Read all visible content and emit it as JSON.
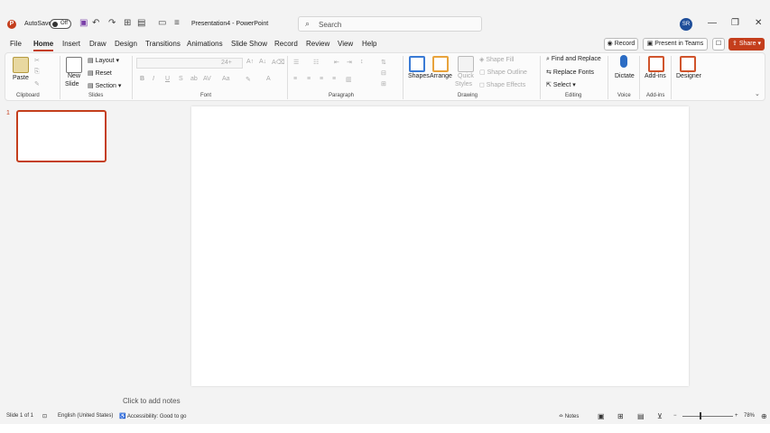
{
  "titlebar": {
    "autosave_label": "AutoSave",
    "autosave_state": "Off",
    "doc_title": "Presentation4 - PowerPoint",
    "search_placeholder": "Search",
    "avatar_initials": "SR"
  },
  "menu": [
    "File",
    "Home",
    "Insert",
    "Draw",
    "Design",
    "Transitions",
    "Animations",
    "Slide Show",
    "Record",
    "Review",
    "View",
    "Help"
  ],
  "menu_active": "Home",
  "actions": {
    "record": "Record",
    "present_teams": "Present in Teams",
    "share": "Share"
  },
  "ribbon": {
    "clipboard": {
      "paste": "Paste",
      "label": "Clipboard"
    },
    "slides": {
      "new_slide_1": "New",
      "new_slide_2": "Slide",
      "layout": "Layout",
      "reset": "Reset",
      "section": "Section",
      "label": "Slides"
    },
    "font": {
      "label": "Font",
      "size": "24+",
      "bold": "B",
      "italic": "I",
      "underline": "U",
      "strike": "S"
    },
    "paragraph": {
      "label": "Paragraph"
    },
    "drawing": {
      "shapes": "Shapes",
      "arrange": "Arrange",
      "quick_styles_1": "Quick",
      "quick_styles_2": "Styles",
      "shape_fill": "Shape Fill",
      "shape_outline": "Shape Outline",
      "shape_effects": "Shape Effects",
      "label": "Drawing"
    },
    "editing": {
      "find_replace": "Find and Replace",
      "replace_fonts": "Replace Fonts",
      "select": "Select",
      "label": "Editing"
    },
    "voice": {
      "dictate": "Dictate",
      "label": "Voice"
    },
    "addins": {
      "addins": "Add-ins",
      "label": "Add-ins"
    },
    "designer": {
      "designer": "Designer"
    }
  },
  "thumbnails": {
    "number": "1"
  },
  "notes_placeholder": "Click to add notes",
  "status": {
    "slide_info": "Slide 1 of 1",
    "language": "English (United States)",
    "accessibility": "Accessibility: Good to go",
    "notes": "Notes",
    "zoom": "78%"
  },
  "colors": {
    "accent": "#c43e1c",
    "avatar": "#1f4e9a"
  }
}
